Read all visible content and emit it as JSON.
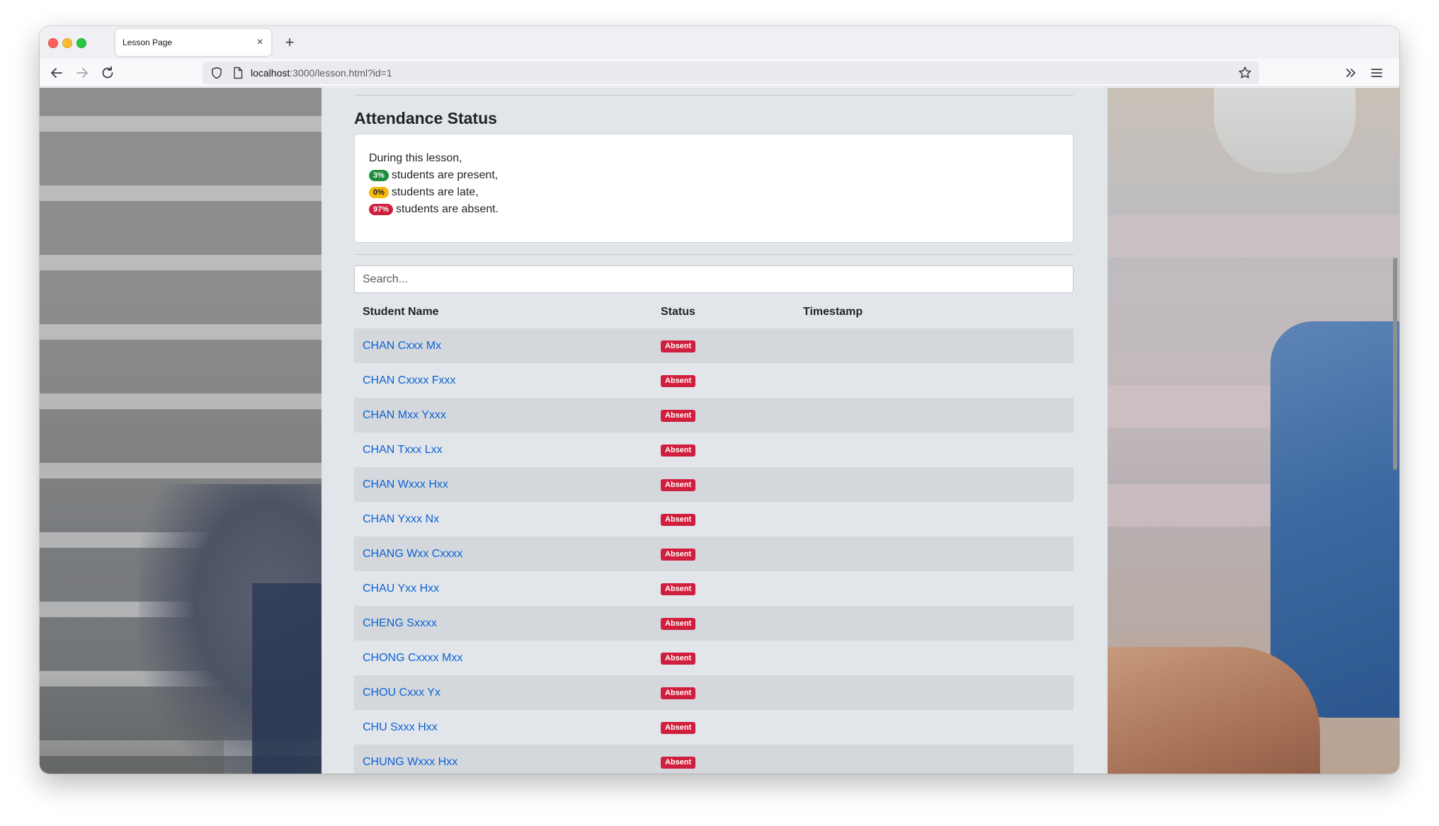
{
  "browser": {
    "tab_title": "Lesson Page",
    "tab_close_glyph": "×",
    "new_tab_glyph": "+",
    "url_host": "localhost",
    "url_rest": ":3000/lesson.html?id=1"
  },
  "attendance": {
    "title": "Attendance Status",
    "intro": "During this lesson,",
    "present_pct": "3%",
    "present_text": "students are present,",
    "late_pct": "0%",
    "late_text": "students are late,",
    "absent_pct": "97%",
    "absent_text": "students are absent."
  },
  "search": {
    "placeholder": "Search..."
  },
  "table": {
    "headers": {
      "name": "Student Name",
      "status": "Status",
      "timestamp": "Timestamp"
    },
    "rows": [
      {
        "name": "CHAN Cxxx Mx",
        "status": "Absent",
        "timestamp": ""
      },
      {
        "name": "CHAN Cxxxx Fxxx",
        "status": "Absent",
        "timestamp": ""
      },
      {
        "name": "CHAN Mxx Yxxx",
        "status": "Absent",
        "timestamp": ""
      },
      {
        "name": "CHAN Txxx Lxx",
        "status": "Absent",
        "timestamp": ""
      },
      {
        "name": "CHAN Wxxx Hxx",
        "status": "Absent",
        "timestamp": ""
      },
      {
        "name": "CHAN Yxxx Nx",
        "status": "Absent",
        "timestamp": ""
      },
      {
        "name": "CHANG Wxx Cxxxx",
        "status": "Absent",
        "timestamp": ""
      },
      {
        "name": "CHAU Yxx Hxx",
        "status": "Absent",
        "timestamp": ""
      },
      {
        "name": "CHENG Sxxxx",
        "status": "Absent",
        "timestamp": ""
      },
      {
        "name": "CHONG Cxxxx Mxx",
        "status": "Absent",
        "timestamp": ""
      },
      {
        "name": "CHOU Cxxx Yx",
        "status": "Absent",
        "timestamp": ""
      },
      {
        "name": "CHU Sxxx Hxx",
        "status": "Absent",
        "timestamp": ""
      },
      {
        "name": "CHUNG Wxxx Hxx",
        "status": "Absent",
        "timestamp": ""
      }
    ]
  },
  "colors": {
    "link": "#0b63d6",
    "present": "#1e8e3e",
    "late": "#f5b80c",
    "absent": "#d01f3c",
    "panel": "#e2e5e9"
  }
}
